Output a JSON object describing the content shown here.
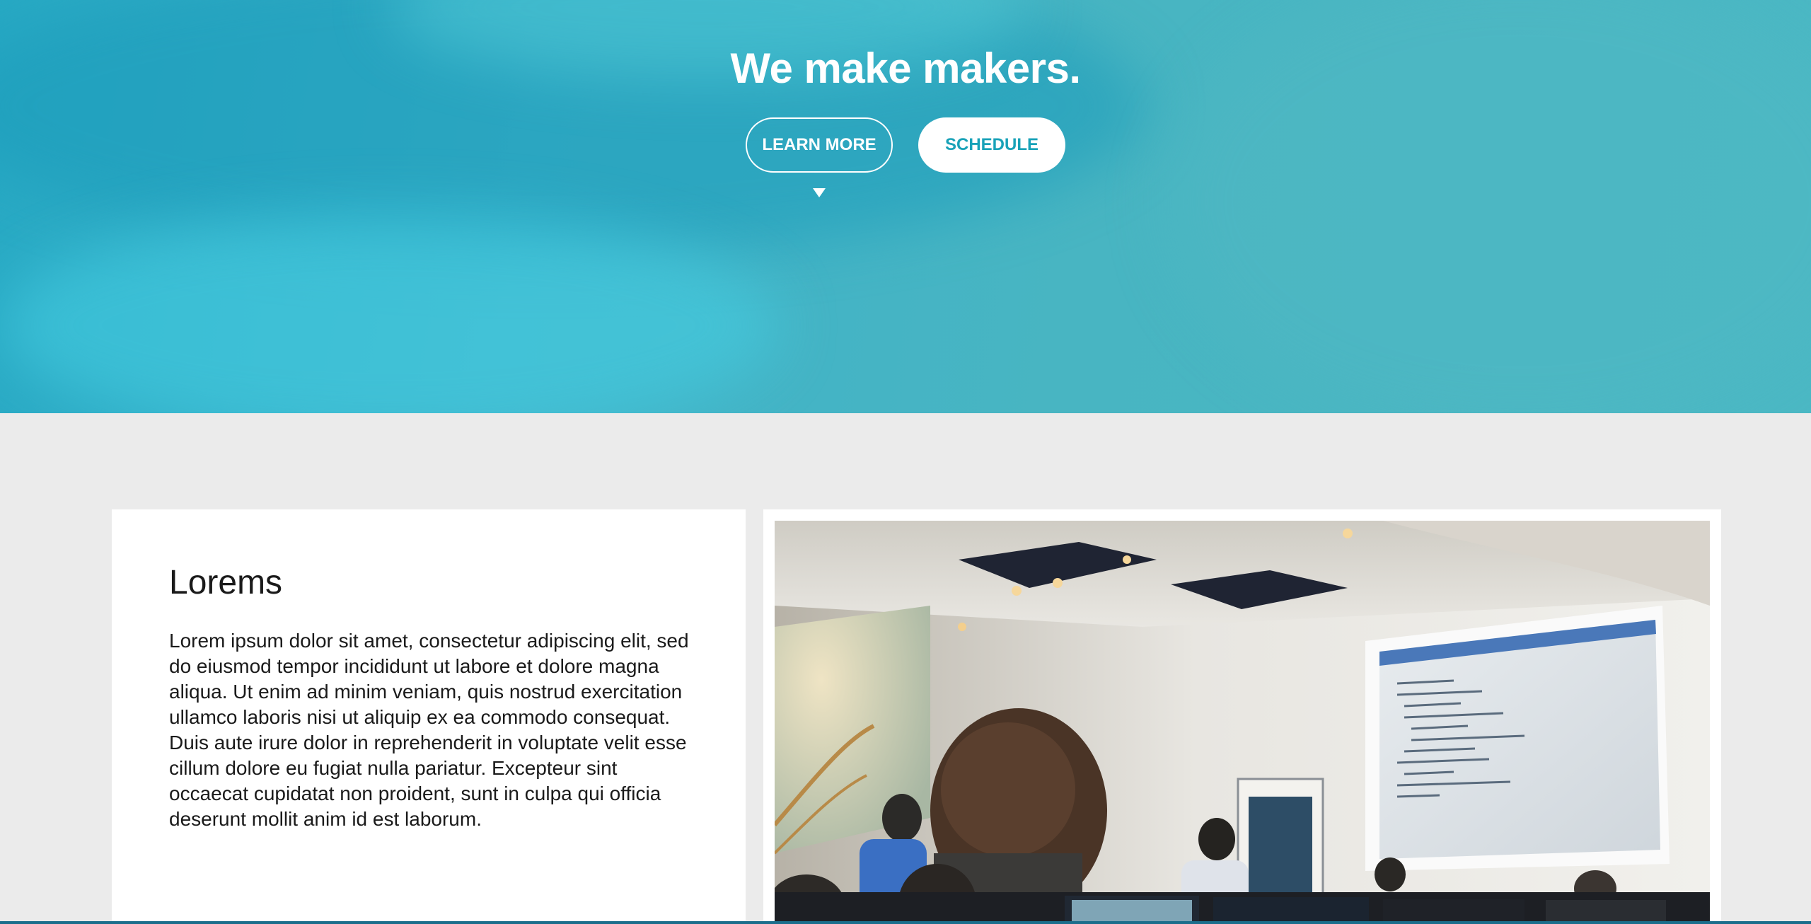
{
  "hero": {
    "title": "We make makers.",
    "buttons": {
      "learn_more": "LEARN MORE",
      "schedule": "SCHEDULE"
    },
    "colors": {
      "accent": "#19a2b8",
      "background": "#3fb3c9"
    },
    "scroll_indicator_icon": "caret-down-icon"
  },
  "section": {
    "title": "Lorems",
    "body": "Lorem ipsum dolor sit amet, consectetur adipiscing elit, sed do eiusmod tempor incididunt ut labore et dolore magna aliqua. Ut enim ad minim veniam, quis nostrud exercitation ullamco laboris nisi ut aliquip ex ea commodo consequat. Duis aute irure dolor in reprehenderit in voluptate velit esse cillum dolore eu fugiat nulla pariatur. Excepteur sint occaecat cupidatat non proident, sunt in culpa qui officia deserunt mollit anim id est laborum.",
    "image": "classroom-photo"
  }
}
